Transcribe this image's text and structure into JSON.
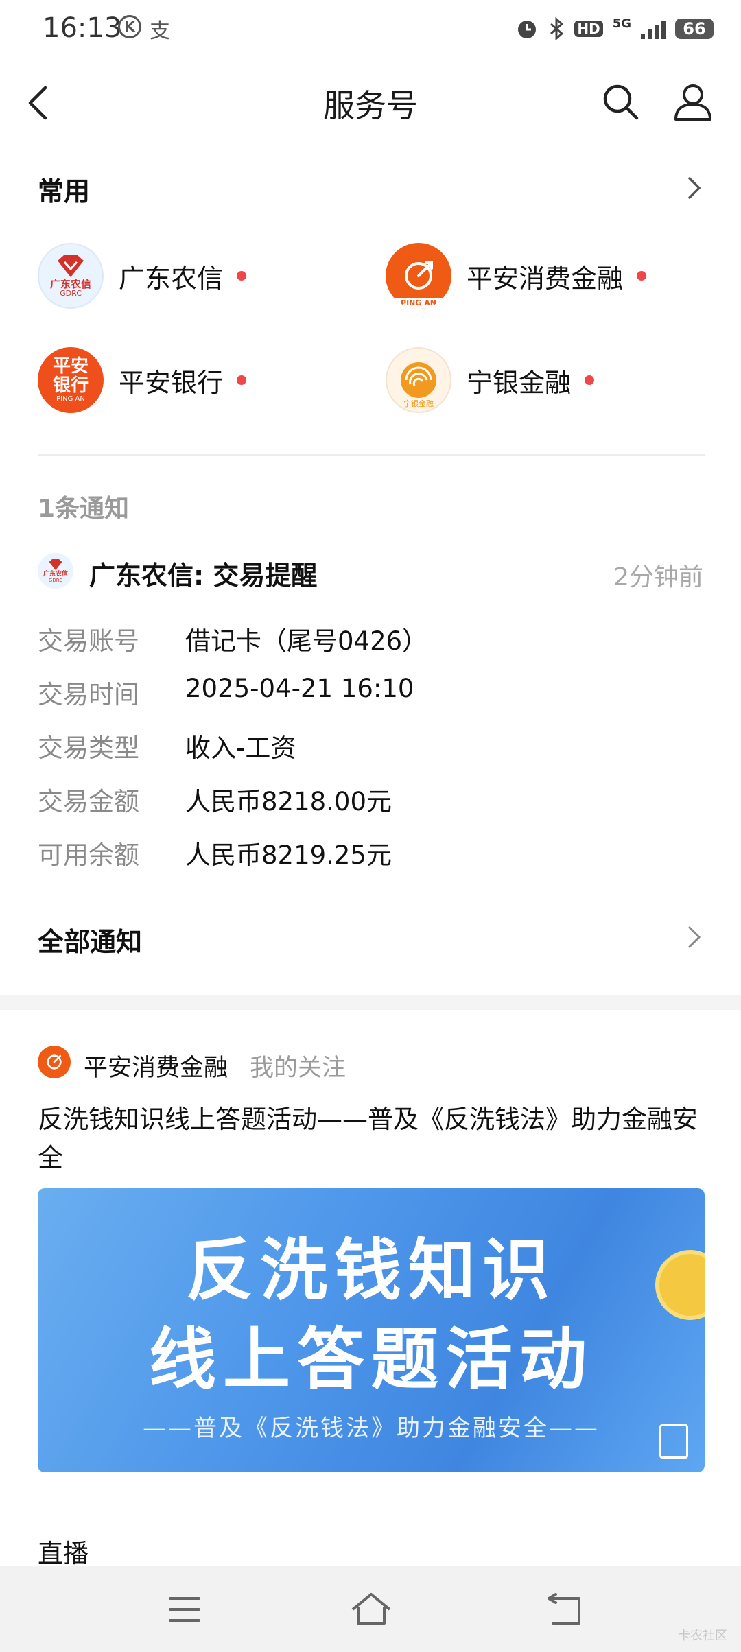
{
  "status_bar": {
    "time": "16:13",
    "icon_k": "K",
    "icon_pay": "支",
    "hd": "HD",
    "network": "5G",
    "battery": "66"
  },
  "header": {
    "title": "服务号"
  },
  "common": {
    "heading": "常用",
    "services": [
      {
        "name": "广东农信",
        "logo_line1": "广东农信",
        "logo_line2": "GDRC"
      },
      {
        "name": "平安消费金融",
        "logo_line1": "PING AN"
      },
      {
        "name": "平安银行",
        "logo_line1": "平安",
        "logo_line2": "银行",
        "logo_line3": "PING AN"
      },
      {
        "name": "宁银金融",
        "logo_line1": "宁银金融"
      }
    ]
  },
  "notification": {
    "count_label": "1条通知",
    "source_logo_line1": "广东农信",
    "source_logo_line2": "GDRC",
    "title": "广东农信: 交易提醒",
    "time": "2分钟前",
    "rows": [
      {
        "label": "交易账号",
        "value": "借记卡（尾号0426）"
      },
      {
        "label": "交易时间",
        "value": "2025-04-21 16:10"
      },
      {
        "label": "交易类型",
        "value": "收入-工资"
      },
      {
        "label": "交易金额",
        "value": "人民币8218.00元"
      },
      {
        "label": "可用余额",
        "value": "人民币8219.25元"
      }
    ],
    "all_label": "全部通知"
  },
  "feed": {
    "source": "平安消费金融",
    "follow_tag": "我的关注",
    "headline": "反洗钱知识线上答题活动——普及《反洗钱法》助力金融安全",
    "banner_line1": "反洗钱知识",
    "banner_line2": "线上答题活动",
    "banner_line3": "——普及《反洗钱法》助力金融安全——"
  },
  "live": {
    "label": "直播"
  },
  "watermark": "卡农社区",
  "colors": {
    "red_dot": "#f04848",
    "pingan_orange": "#ef5a14",
    "gdrc_red": "#d4312a",
    "banner_blue": "#4e97ea"
  }
}
